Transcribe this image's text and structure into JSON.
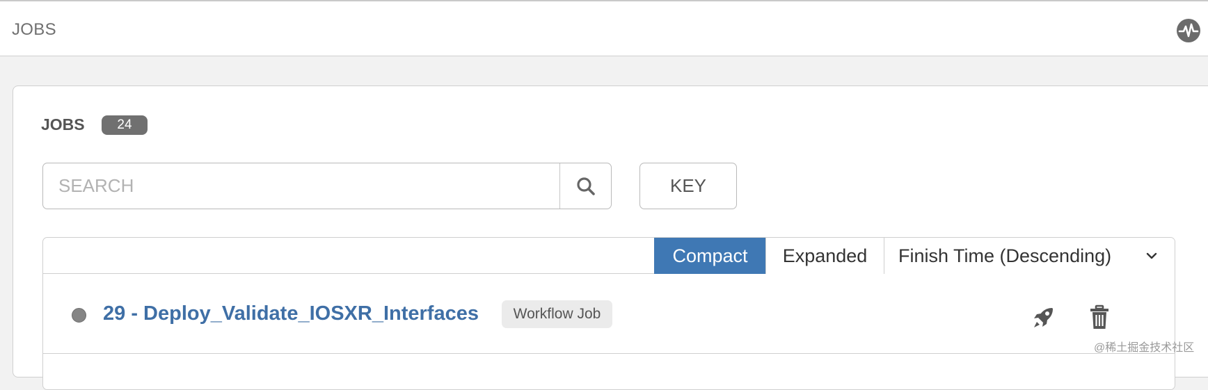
{
  "header": {
    "title": "JOBS",
    "activity_icon": "activity-stream-icon"
  },
  "jobs_panel": {
    "title": "JOBS",
    "count": "24",
    "search": {
      "placeholder": "SEARCH",
      "value": "",
      "icon": "search-icon"
    },
    "key_button": "KEY",
    "view_toggle": {
      "compact": "Compact",
      "expanded": "Expanded",
      "active": "compact"
    },
    "sort": {
      "selected": "Finish Time (Descending)",
      "icon": "chevron-down-icon"
    },
    "jobs": [
      {
        "label": "29 - Deploy_Validate_IOSXR_Interfaces",
        "type": "Workflow Job",
        "status_color": "#858585",
        "actions": [
          "rocket-icon",
          "trash-icon"
        ]
      }
    ]
  },
  "colors": {
    "accent": "#3f78b4",
    "link": "#3f6fa6",
    "badge": "#707070"
  },
  "watermark": "@稀土掘金技术社区"
}
